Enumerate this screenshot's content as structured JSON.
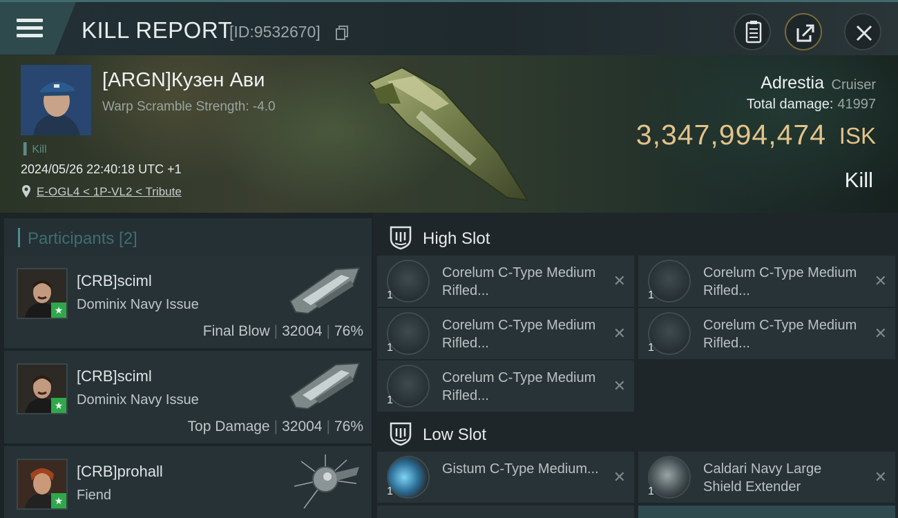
{
  "topbar": {
    "title": "KILL REPORT",
    "report_id": "[ID:9532670]"
  },
  "victim": {
    "name": "[ARGN]Кузен Ави",
    "warp_scramble": "Warp Scramble Strength: -4.0",
    "tag": "Kill",
    "datetime": "2024/05/26 22:40:18 UTC +1",
    "location": "E-OGL4 < 1P-VL2 < Tribute",
    "ship_name": "Adrestia",
    "ship_class": "Cruiser",
    "total_damage_label": "Total damage:",
    "total_damage": "41997",
    "isk_value": "3,347,994,474",
    "isk_unit": "ISK",
    "result": "Kill"
  },
  "participants": {
    "header": "Participants [2]",
    "rows": [
      {
        "name": "[CRB]sciml",
        "ship": "Dominix Navy Issue",
        "role": "Final Blow",
        "damage": "32004",
        "percent": "76%"
      },
      {
        "name": "[CRB]sciml",
        "ship": "Dominix Navy Issue",
        "role": "Top Damage",
        "damage": "32004",
        "percent": "76%"
      },
      {
        "name": "[CRB]prohall",
        "ship": "Fiend"
      }
    ]
  },
  "slots": {
    "high": {
      "label": "High Slot",
      "items": [
        {
          "qty": "1",
          "name": "Corelum C-Type Medium Rifled..."
        },
        {
          "qty": "1",
          "name": "Corelum C-Type Medium Rifled..."
        },
        {
          "qty": "1",
          "name": "Corelum C-Type Medium Rifled..."
        },
        {
          "qty": "1",
          "name": "Corelum C-Type Medium Rifled..."
        },
        {
          "qty": "1",
          "name": "Corelum C-Type Medium Rifled..."
        }
      ]
    },
    "low": {
      "label": "Low Slot",
      "items": [
        {
          "qty": "1",
          "name": "Gistum C-Type Medium..."
        },
        {
          "qty": "1",
          "name": "Caldari Navy Large Shield Extender"
        }
      ]
    }
  },
  "icons": {
    "menu": "menu-icon",
    "copy": "copy-icon",
    "clipboard": "clipboard-icon",
    "share": "share-icon",
    "close": "close-icon",
    "location": "location-pin-icon",
    "slot": "slot-shield-icon",
    "remove": "x-icon"
  },
  "colors": {
    "accent": "#4e8f8c",
    "isk": "#e3c38a",
    "star": "#2ea84a"
  }
}
